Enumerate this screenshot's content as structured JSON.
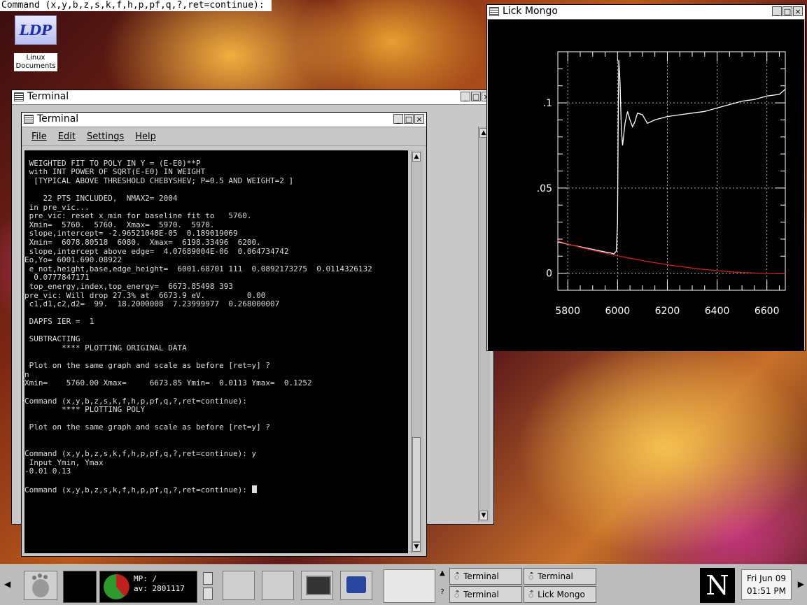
{
  "cmdline": "Command (x,y,b,z,s,k,f,h,p,pf,q,?,ret=continue): ",
  "desktop": {
    "icon_logo": "LDP",
    "icon_label_line1": "Linux",
    "icon_label_line2": "Documents"
  },
  "terminal_back": {
    "title": "Terminal"
  },
  "terminal": {
    "title": "Terminal",
    "menu": [
      "File",
      "Edit",
      "Settings",
      "Help"
    ],
    "lines": [
      "",
      " WEIGHTED FIT TO POLY IN Y = (E-E0)**P",
      " with INT POWER OF SQRT(E-E0) IN WEIGHT",
      "  [TYPICAL ABOVE THRESHOLD CHEBYSHEV; P=0.5 AND WEIGHT=2 ]",
      "",
      "    22 PTS INCLUDED,  NMAX2= 2004",
      " in pre_vic...",
      " pre_vic: reset x_min for baseline fit to   5760.",
      " Xmin=  5760.  5760.  Xmax=  5970.  5970.",
      " slope,intercept= -2.96521048E-05  0.189019069",
      " Xmin=  6078.80518  6080.  Xmax=  6198.33496  6200.",
      " slope,intercept above edge=  4.07689004E-06  0.064734742",
      "Eo,Yo= 6001.690.08922",
      " e_not,height,base,edge_height=  6001.68701 111  0.0892173275  0.0114326132",
      "  0.0777847171",
      " top_energy,index,top_energy=  6673.85498 393",
      "pre_vic: Will drop 27.3% at  6673.9 eV.         0.00",
      " c1,d1,c2,d2=  99.  18.2000008  7.23999977  0.268000007",
      "",
      " DAPFS IER =  1",
      "",
      " SUBTRACTING",
      "        **** PLOTTING ORIGINAL DATA",
      "",
      " Plot on the same graph and scale as before [ret=y] ?",
      "n",
      "Xmin=    5760.00 Xmax=     6673.85 Ymin=  0.0113 Ymax=  0.1252",
      "",
      "Command (x,y,b,z,s,k,f,h,p,pf,q,?,ret=continue):",
      "        **** PLOTTING POLY",
      "",
      " Plot on the same graph and scale as before [ret=y] ?",
      "",
      "",
      "Command (x,y,b,z,s,k,f,h,p,pf,q,?,ret=continue): y",
      " Input Ymin, Ymax",
      "-0.01 0.13",
      ""
    ],
    "prompt": "Command (x,y,b,z,s,k,f,h,p,pf,q,?,ret=continue): "
  },
  "mongo": {
    "title": "Lick Mongo",
    "colors": {
      "data": "#ffffff",
      "poly": "#d02020",
      "grid": "#cccccc",
      "axis": "#ffffff"
    }
  },
  "chart_data": {
    "type": "line",
    "title": "",
    "xlabel": "",
    "ylabel": "",
    "xlim": [
      5760,
      6674
    ],
    "ylim": [
      -0.01,
      0.13
    ],
    "xticks": [
      "5800",
      "6000",
      "6200",
      "6400",
      "6600"
    ],
    "yticks": [
      ".1",
      ".05",
      "0"
    ],
    "grid": true,
    "series": [
      {
        "color": "#ffffff",
        "x": [
          5760,
          5800,
          5850,
          5900,
          5950,
          5975,
          5985,
          5995,
          6000,
          6002,
          6005,
          6010,
          6015,
          6020,
          6030,
          6040,
          6050,
          6060,
          6070,
          6080,
          6100,
          6120,
          6150,
          6200,
          6250,
          6300,
          6350,
          6400,
          6450,
          6500,
          6550,
          6600,
          6650,
          6674
        ],
        "y": [
          0.0185,
          0.017,
          0.0155,
          0.014,
          0.0125,
          0.0118,
          0.0113,
          0.013,
          0.03,
          0.08,
          0.1252,
          0.112,
          0.085,
          0.075,
          0.088,
          0.095,
          0.09,
          0.086,
          0.089,
          0.094,
          0.093,
          0.088,
          0.09,
          0.092,
          0.093,
          0.094,
          0.095,
          0.097,
          0.099,
          0.101,
          0.102,
          0.104,
          0.105,
          0.108
        ]
      },
      {
        "color": "#d02020",
        "x": [
          5760,
          5800,
          5850,
          5900,
          5950,
          6000,
          6050,
          6100,
          6150,
          6200,
          6250,
          6300,
          6350,
          6400,
          6450,
          6500,
          6550,
          6600,
          6674
        ],
        "y": [
          0.019,
          0.0172,
          0.0152,
          0.0135,
          0.0118,
          0.0102,
          0.0088,
          0.0074,
          0.0062,
          0.005,
          0.004,
          0.003,
          0.0022,
          0.0015,
          0.0009,
          0.0004,
          0.0001,
          0.0,
          0.0
        ]
      }
    ]
  },
  "taskbar": {
    "monitor_line1": "MP: /",
    "monitor_line2": "av: 2801117",
    "tasks": [
      "Terminal",
      "Terminal",
      "Terminal",
      "Lick Mongo"
    ],
    "netscape_letter": "N",
    "clock_date": "Fri Jun 09",
    "clock_time": "01:51 PM"
  }
}
